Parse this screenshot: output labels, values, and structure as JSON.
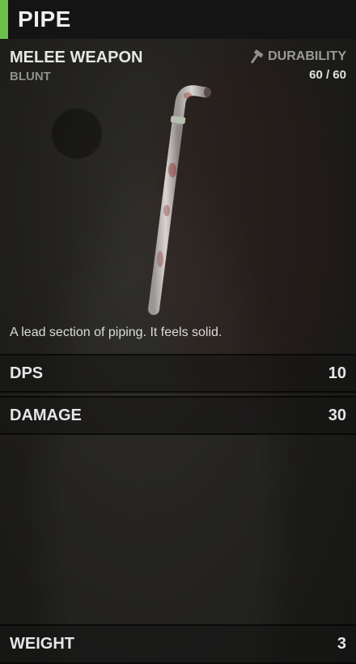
{
  "item": {
    "name": "PIPE",
    "type": "MELEE WEAPON",
    "subtype": "BLUNT",
    "durability_label": "DURABILITY",
    "durability_value": "60 / 60",
    "durability_icon": "hammer-icon",
    "description": "A lead section of piping. It feels solid."
  },
  "stats": {
    "dps_label": "DPS",
    "dps_value": "10",
    "damage_label": "DAMAGE",
    "damage_value": "30",
    "weight_label": "WEIGHT",
    "weight_value": "3"
  },
  "colors": {
    "accent": "#6cc04a",
    "header_bg": "#141414",
    "panel_bg": "#1f1e1b",
    "muted_text": "#8f8f8f"
  }
}
